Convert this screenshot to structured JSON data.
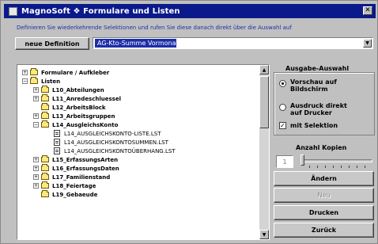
{
  "window": {
    "title": "MagnoSoft ❖ Formulare und Listen",
    "close_label": "✕"
  },
  "instruction": "Definieren Sie wiederkehrende Selektionen und rufen Sie diese danach direkt über die Auswahl auf",
  "toolbar": {
    "new_definition_label": "neue Definition",
    "selection_value": "AG-Kto-Summe Vormonat"
  },
  "tree": {
    "items": [
      {
        "label": "Formulare / Aufkleber",
        "expander": "+",
        "icon": "folder-icon",
        "bold": true
      },
      {
        "label": "Listen",
        "expander": "−",
        "icon": "folder-open-icon",
        "bold": true
      },
      {
        "label": "L10_Abteilungen",
        "expander": "+",
        "icon": "folder-icon",
        "bold": true
      },
      {
        "label": "L11_Anredeschluessel",
        "expander": "+",
        "icon": "folder-icon",
        "bold": true
      },
      {
        "label": "L12_ArbeitsBlock",
        "expander": "",
        "icon": "folder-icon",
        "bold": true
      },
      {
        "label": "L13_Arbeitsgruppen",
        "expander": "+",
        "icon": "folder-icon",
        "bold": true
      },
      {
        "label": "L14_AusgleichsKonto",
        "expander": "−",
        "icon": "folder-open-icon",
        "bold": true
      },
      {
        "label": "L14_AUSGLEICHSKONTO-LISTE.LST",
        "expander": "",
        "icon": "document-icon",
        "bold": false
      },
      {
        "label": "L14_AUSGLEICHSKONTOSUMMEN.LST",
        "expander": "",
        "icon": "document-icon",
        "bold": false
      },
      {
        "label": "L14_AUSGLEICHSKONTOÜBERHANG.LST",
        "expander": "",
        "icon": "document-icon",
        "bold": false
      },
      {
        "label": "L15_ErfassungsArten",
        "expander": "+",
        "icon": "folder-icon",
        "bold": true
      },
      {
        "label": "L16_ErfassungsDaten",
        "expander": "+",
        "icon": "folder-icon",
        "bold": true
      },
      {
        "label": "L17_Familienstand",
        "expander": "+",
        "icon": "folder-icon",
        "bold": true
      },
      {
        "label": "L18_Feiertage",
        "expander": "+",
        "icon": "folder-icon",
        "bold": true
      },
      {
        "label": "L19_Gebaeude",
        "expander": "",
        "icon": "folder-icon",
        "bold": true
      }
    ]
  },
  "output": {
    "group_title": "Ausgabe-Auswahl",
    "preview_line1": "Vorschau auf",
    "preview_line2": "Bildschirm",
    "print_line1": "Ausdruck direkt",
    "print_line2": "auf Drucker",
    "selection_label": "mit Selektion",
    "preview_selected": true,
    "selection_checked": true
  },
  "copies": {
    "label": "Anzahl Kopien",
    "value": "1"
  },
  "buttons": {
    "change_label": "Ändern",
    "new_label": "Neu",
    "print_label": "Drucken",
    "back_label": "Zurück"
  },
  "colors": {
    "titlebar": "#0a1a8a",
    "selection": "#1c2fa8",
    "instruction_text": "#1c2fa8",
    "window_bg": "#c0c0c0"
  }
}
